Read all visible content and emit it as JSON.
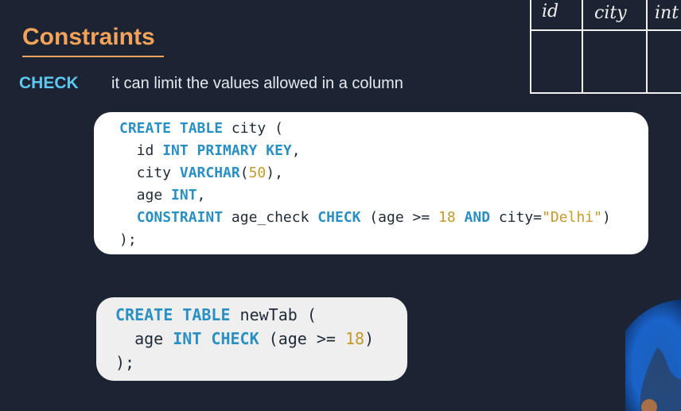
{
  "slide": {
    "title": "Constraints",
    "check_label": "CHECK",
    "check_description": "it can limit the values allowed in a column"
  },
  "code_block_1": {
    "lines": [
      [
        {
          "t": "CREATE TABLE",
          "c": "kw"
        },
        {
          "t": " city (",
          "c": ""
        }
      ],
      [
        {
          "t": "  id ",
          "c": ""
        },
        {
          "t": "INT PRIMARY KEY",
          "c": "kw"
        },
        {
          "t": ",",
          "c": ""
        }
      ],
      [
        {
          "t": "  city ",
          "c": ""
        },
        {
          "t": "VARCHAR",
          "c": "kw"
        },
        {
          "t": "(",
          "c": ""
        },
        {
          "t": "50",
          "c": "num"
        },
        {
          "t": "),",
          "c": ""
        }
      ],
      [
        {
          "t": "  age ",
          "c": ""
        },
        {
          "t": "INT",
          "c": "kw"
        },
        {
          "t": ",",
          "c": ""
        }
      ],
      [
        {
          "t": "  ",
          "c": ""
        },
        {
          "t": "CONSTRAINT",
          "c": "kw"
        },
        {
          "t": " age_check ",
          "c": ""
        },
        {
          "t": "CHECK",
          "c": "kw"
        },
        {
          "t": " (age >= ",
          "c": ""
        },
        {
          "t": "18",
          "c": "num"
        },
        {
          "t": " ",
          "c": ""
        },
        {
          "t": "AND",
          "c": "kw"
        },
        {
          "t": " city=",
          "c": ""
        },
        {
          "t": "\"Delhi\"",
          "c": "str"
        },
        {
          "t": ")",
          "c": ""
        }
      ],
      [
        {
          "t": ");",
          "c": ""
        }
      ]
    ]
  },
  "code_block_2": {
    "lines": [
      [
        {
          "t": "CREATE TABLE",
          "c": "kw"
        },
        {
          "t": " newTab (",
          "c": ""
        }
      ],
      [
        {
          "t": "  age ",
          "c": ""
        },
        {
          "t": "INT CHECK",
          "c": "kw"
        },
        {
          "t": " (age >= ",
          "c": ""
        },
        {
          "t": "18",
          "c": "num"
        },
        {
          "t": ")",
          "c": ""
        }
      ],
      [
        {
          "t": ");",
          "c": ""
        }
      ]
    ]
  },
  "sketch_table": {
    "headers": [
      "id",
      "city",
      "int"
    ]
  }
}
